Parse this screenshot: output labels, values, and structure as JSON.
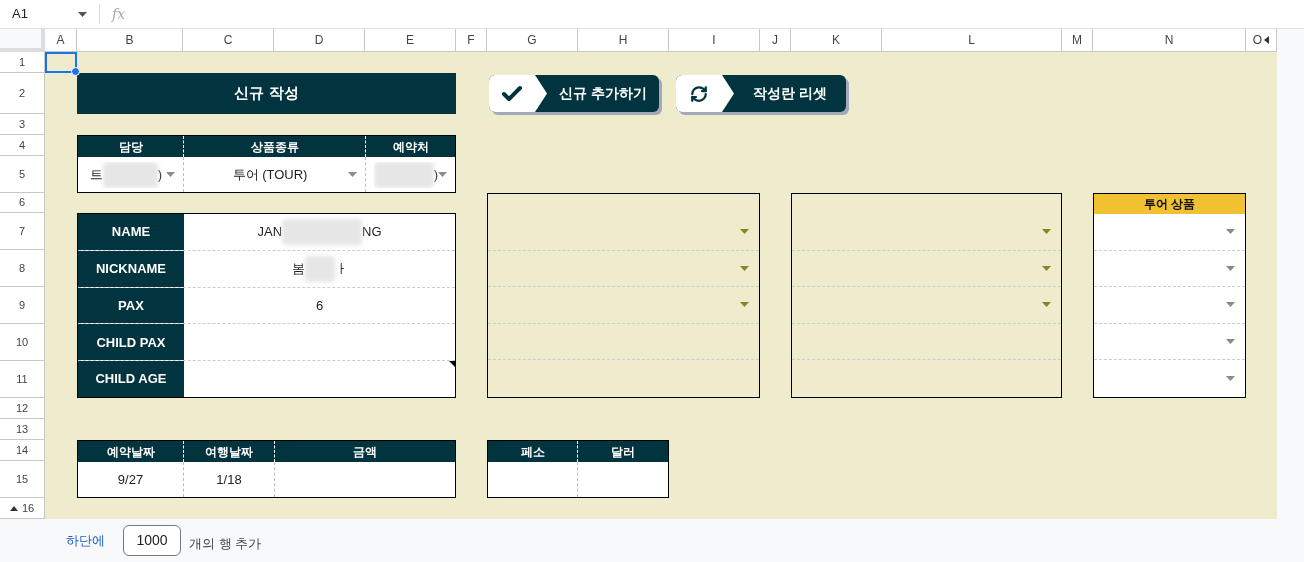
{
  "formula_bar": {
    "cell_ref": "A1",
    "fx": "fx"
  },
  "columns": [
    "A",
    "B",
    "C",
    "D",
    "E",
    "F",
    "G",
    "H",
    "I",
    "J",
    "K",
    "L",
    "M",
    "N",
    "O"
  ],
  "rows": [
    "1",
    "2",
    "3",
    "4",
    "5",
    "6",
    "7",
    "8",
    "9",
    "10",
    "11",
    "12",
    "13",
    "14",
    "15",
    "16"
  ],
  "title": "신규 작성",
  "buttons": [
    {
      "kind": "check",
      "label": "신규 추가하기"
    },
    {
      "kind": "refresh",
      "label": "작성란 리셋"
    }
  ],
  "booking": [
    {
      "header": "담당",
      "value_parts": [
        "트",
        ")"
      ],
      "redacted": true,
      "dropdown": true
    },
    {
      "header": "상품종류",
      "value_parts": [
        "투어 (TOUR)"
      ],
      "redacted": false,
      "dropdown": true
    },
    {
      "header": "예약처",
      "value_parts": [
        ")"
      ],
      "redacted": true,
      "dropdown": true
    }
  ],
  "info": [
    {
      "label": "NAME",
      "value_parts": [
        "JAN",
        "NG"
      ],
      "redacted": true,
      "has_note": false
    },
    {
      "label": "NICKNAME",
      "value_parts": [
        "봄",
        "ㅏ"
      ],
      "redacted": true,
      "has_note": false
    },
    {
      "label": "PAX",
      "value_parts": [
        "6"
      ],
      "redacted": false,
      "has_note": false
    },
    {
      "label": "CHILD PAX",
      "has_note": false
    },
    {
      "label": "CHILD AGE",
      "has_note": true
    }
  ],
  "panels": [
    {
      "kind": "plain",
      "rows": [
        {
          "dropdown": true
        },
        {
          "dropdown": true
        },
        {
          "dropdown": true
        },
        {
          "dropdown": false
        },
        {
          "dropdown": false
        }
      ]
    },
    {
      "kind": "plain",
      "rows": [
        {
          "dropdown": true
        },
        {
          "dropdown": true
        },
        {
          "dropdown": true
        },
        {
          "dropdown": false
        },
        {
          "dropdown": false
        }
      ]
    },
    {
      "kind": "header",
      "title": "투어 상품",
      "rows": [
        {
          "dropdown": true
        },
        {
          "dropdown": true
        },
        {
          "dropdown": true
        },
        {
          "dropdown": true
        },
        {
          "dropdown": true
        }
      ]
    }
  ],
  "dates": [
    {
      "header": "예약날짜",
      "value": "9/27"
    },
    {
      "header": "여행날짜",
      "value": "1/18"
    },
    {
      "header": "금액"
    }
  ],
  "currency": [
    {
      "header": "페소"
    },
    {
      "header": "달러"
    }
  ],
  "footer": {
    "link": "하단에",
    "count": "1000",
    "suffix": "개의 행 추가"
  }
}
